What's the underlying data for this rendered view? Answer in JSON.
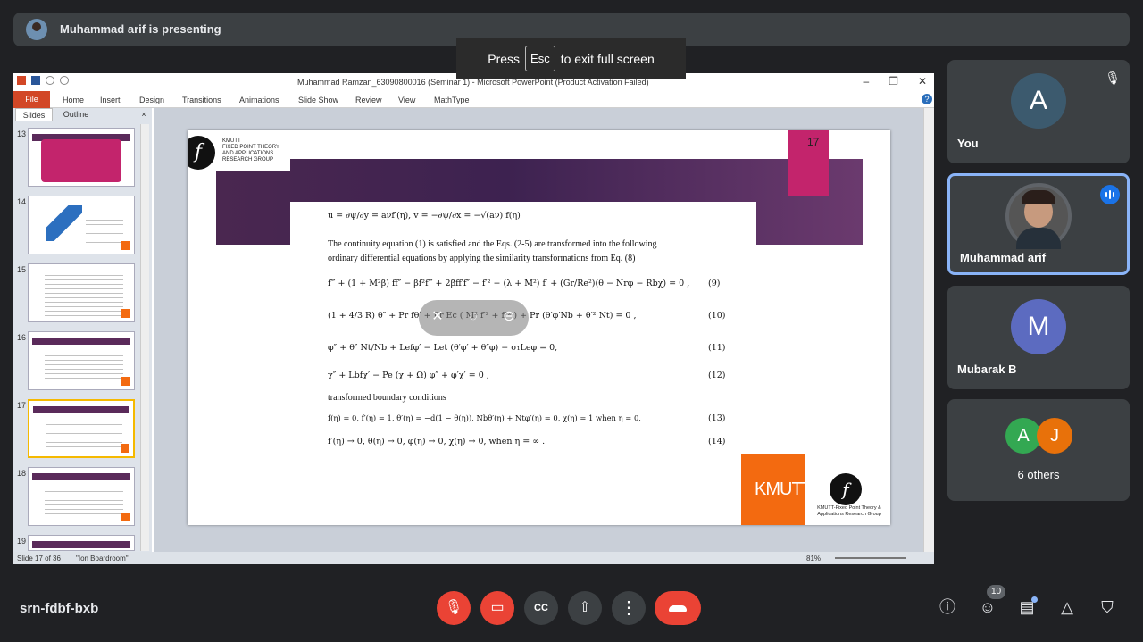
{
  "presenter_bar": {
    "text": "Muhammad arif is presenting"
  },
  "esc_toast": {
    "press": "Press",
    "key": "Esc",
    "suffix": "to exit full screen"
  },
  "powerpoint": {
    "window_title": "Muhammad Ramzan_63090800016 (Seminar 1)  -  Microsoft PowerPoint (Product Activation Failed)",
    "ribbon_tabs": [
      "File",
      "Home",
      "Insert",
      "Design",
      "Transitions",
      "Animations",
      "Slide Show",
      "Review",
      "View",
      "MathType"
    ],
    "pane_tabs": {
      "slides": "Slides",
      "outline": "Outline",
      "close": "×"
    },
    "thumbnails": [
      "13",
      "14",
      "15",
      "16",
      "17",
      "18",
      "19"
    ],
    "selected_slide": "17",
    "status": {
      "slide": "Slide 17 of 36",
      "theme": "\"Ion Boardroom\"",
      "zoom": "81%"
    }
  },
  "slide": {
    "header_logo": {
      "glyph": "f",
      "lines": [
        "KMUTT",
        "FIXED POINT THEORY",
        "AND APPLICATIONS",
        "RESEARCH GROUP"
      ]
    },
    "page_number": "17",
    "eq_top": "u = ∂ψ/∂y = aνf′(η), v = −∂ψ/∂x = −√(aν) f(η)",
    "para1": "The continuity equation (1) is satisfied and the Eqs. (2-5) are transformed into the following",
    "para2": "ordinary differential equations by applying the similarity transformations from Eq. (8)",
    "equations": [
      {
        "text": "f‴ + (1 + M²β) ff″ − βf²f‴ + 2βff′f″ − f′² − (λ + M²) f′ + (Gr/Re²)(θ − Nrφ − Rbχ) = 0 ,",
        "num": "(9)"
      },
      {
        "text": "(1 + 4/3 R) θ″ + Pr fθ′ + Pr Ec ( M² f′² + f″² ) + Pr (θ′φ′Nb + θ′² Nt) = 0 ,",
        "num": "(10)"
      },
      {
        "text": "φ″ + θ″ Nt/Nb + Lefφ′ − Let (θ′φ′ + θ″φ) − σ₁Leφ = 0,",
        "num": "(11)"
      },
      {
        "text": "χ″ + Lbfχ′ − Pe (χ + Ω) φ″ + φ′χ′ = 0 ,",
        "num": "(12)"
      }
    ],
    "bc_heading": "transformed boundary conditions",
    "bc_equations": [
      {
        "text": "f(η) = 0, f′(η) = 1, θ′(η) = −d(1 − θ(η)), Nbθ′(η) + Ntφ′(η) = 0, χ(η) = 1  when  η = 0,",
        "num": "(13)"
      },
      {
        "text": "f′(η) → 0, θ(η) → 0, φ(η) → 0, χ(η) → 0,  when  η = ∞ .",
        "num": "(14)"
      }
    ],
    "kmutt_logo": "KMUTT",
    "footer_logo_glyph": "f",
    "footer_text": [
      "KMUTT-Fixed Point Theory &",
      "Applications Research Group"
    ]
  },
  "participants": [
    {
      "name": "You",
      "initial": "A",
      "color": "#3c5a6e",
      "muted": true
    },
    {
      "name": "Muhammad arif",
      "speaking": true
    },
    {
      "name": "Mubarak B",
      "initial": "M",
      "color": "#5c6bc0"
    },
    {
      "name": "6 others",
      "initials": [
        "A",
        "J"
      ],
      "colors": [
        "#33a852",
        "#e8710a"
      ]
    }
  ],
  "bottom_bar": {
    "meeting_code": "srn-fdbf-bxb",
    "people_count": "10"
  }
}
